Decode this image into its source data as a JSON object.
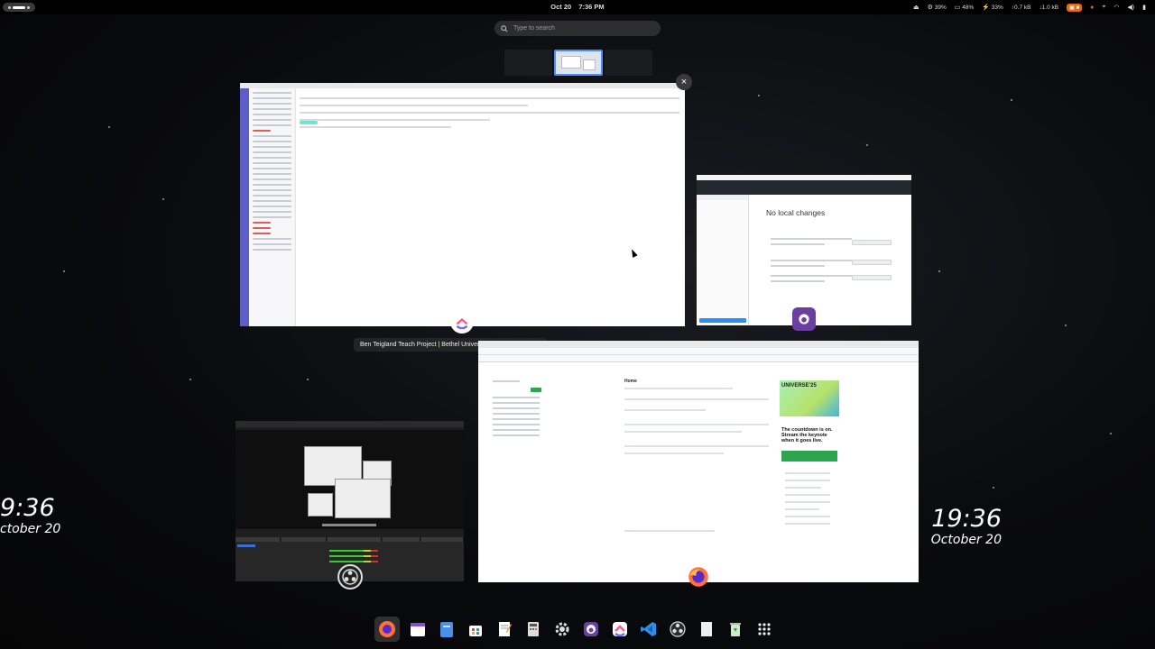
{
  "topbar": {
    "date": "Oct 20",
    "time": "7:36 PM",
    "tray": {
      "cpu": "39%",
      "memory": "48%",
      "temp": "33%",
      "upload": "0.7 kB",
      "download": "1.0 kB"
    }
  },
  "search": {
    "placeholder": "Type to search"
  },
  "windows": {
    "clickup_tooltip": "Ben Teigland Teach Project | Bethel University Rocket Club (List)",
    "github_desktop": {
      "heading": "No local changes"
    },
    "firefox": {
      "home_label": "Home",
      "universe_title": "UNIVERSE'25",
      "countdown": "The countdown is on. Stream the keynote when it goes live."
    }
  },
  "desktop_clock": {
    "left_time": "9:36",
    "left_date": "ctober 20",
    "right_time": "19:36",
    "right_date": "October 20"
  },
  "dock": {
    "items": [
      "firefox-icon",
      "calendar-icon",
      "files-icon",
      "software-store-icon",
      "text-editor-icon",
      "calculator-icon",
      "settings-icon",
      "github-desktop-icon",
      "clickup-icon",
      "vscode-icon",
      "obs-icon",
      "blank-document-icon",
      "trash-icon",
      "app-grid-icon"
    ]
  },
  "colors": {
    "accent_blue": "#4d8dfc",
    "github_green": "#2da44e",
    "clickup_purple": "#5b5fc7",
    "tray_orange": "#e06a1a"
  }
}
